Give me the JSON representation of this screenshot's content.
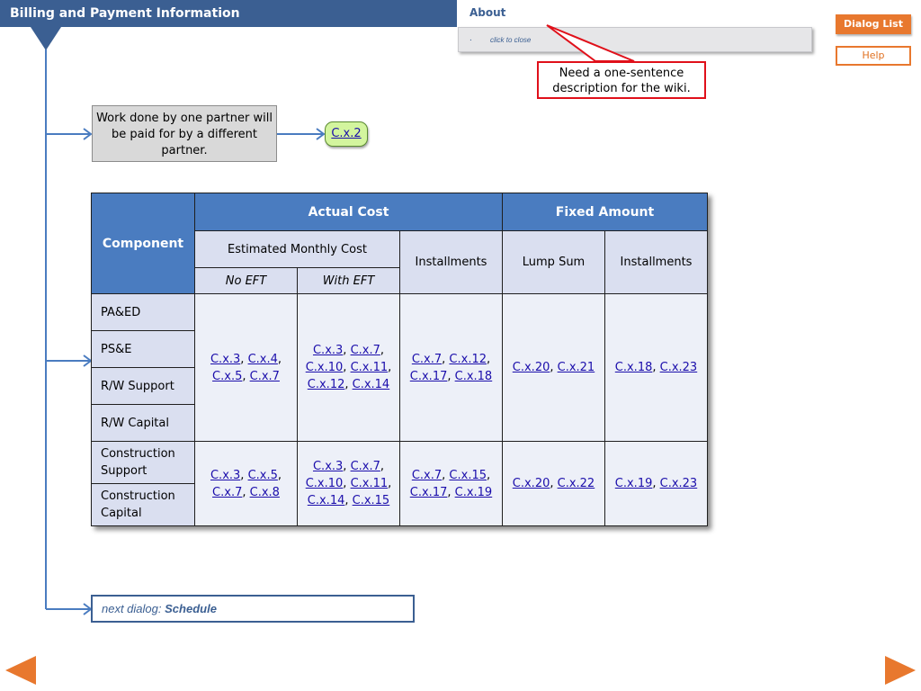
{
  "header": {
    "title": "Billing and Payment Information"
  },
  "about": {
    "title": "About",
    "bullet": ".",
    "close_text": "click to close",
    "callout": "Need a one-sentence description for the wiki."
  },
  "buttons": {
    "dialog_list": "Dialog List",
    "help": "Help"
  },
  "note": {
    "text": "Work done by one partner will be paid for by a different partner.",
    "link": "C.x.2"
  },
  "table": {
    "component": "Component",
    "actual_cost": "Actual Cost",
    "fixed_amount": "Fixed Amount",
    "estimated_monthly": "Estimated Monthly Cost",
    "installments": "Installments",
    "lump_sum": "Lump Sum",
    "installments_fixed": "Installments",
    "no_eft": "No EFT",
    "with_eft": "With EFT",
    "rows": [
      "PA&ED",
      "PS&E",
      "R/W Support",
      "R/W Capital",
      "Construction Support",
      "Construction Capital"
    ],
    "group1": {
      "no_eft": [
        "C.x.3",
        "C.x.4",
        "C.x.5",
        "C.x.7"
      ],
      "with_eft": [
        "C.x.3",
        "C.x.7",
        "C.x.10",
        "C.x.11",
        "C.x.12",
        "C.x.14"
      ],
      "installments": [
        "C.x.7",
        "C.x.12",
        "C.x.17",
        "C.x.18"
      ],
      "lump_sum": [
        "C.x.20",
        "C.x.21"
      ],
      "installments_fixed": [
        "C.x.18",
        "C.x.23"
      ]
    },
    "group2": {
      "no_eft": [
        "C.x.3",
        "C.x.5",
        "C.x.7",
        "C.x.8"
      ],
      "with_eft": [
        "C.x.3",
        "C.x.7",
        "C.x.10",
        "C.x.11",
        "C.x.14",
        "C.x.15"
      ],
      "installments": [
        "C.x.7",
        "C.x.15",
        "C.x.17",
        "C.x.19"
      ],
      "lump_sum": [
        "C.x.20",
        "C.x.22"
      ],
      "installments_fixed": [
        "C.x.19",
        "C.x.23"
      ]
    }
  },
  "next_dialog": {
    "label": "next dialog:",
    "link": "Schedule"
  },
  "colors": {
    "accent": "#3b5f92",
    "orange": "#e8782e",
    "callout_red": "#e0101a",
    "link_green": "#d3f59e"
  },
  "icons": {
    "prev": "left-arrow-icon",
    "next": "right-arrow-icon"
  }
}
